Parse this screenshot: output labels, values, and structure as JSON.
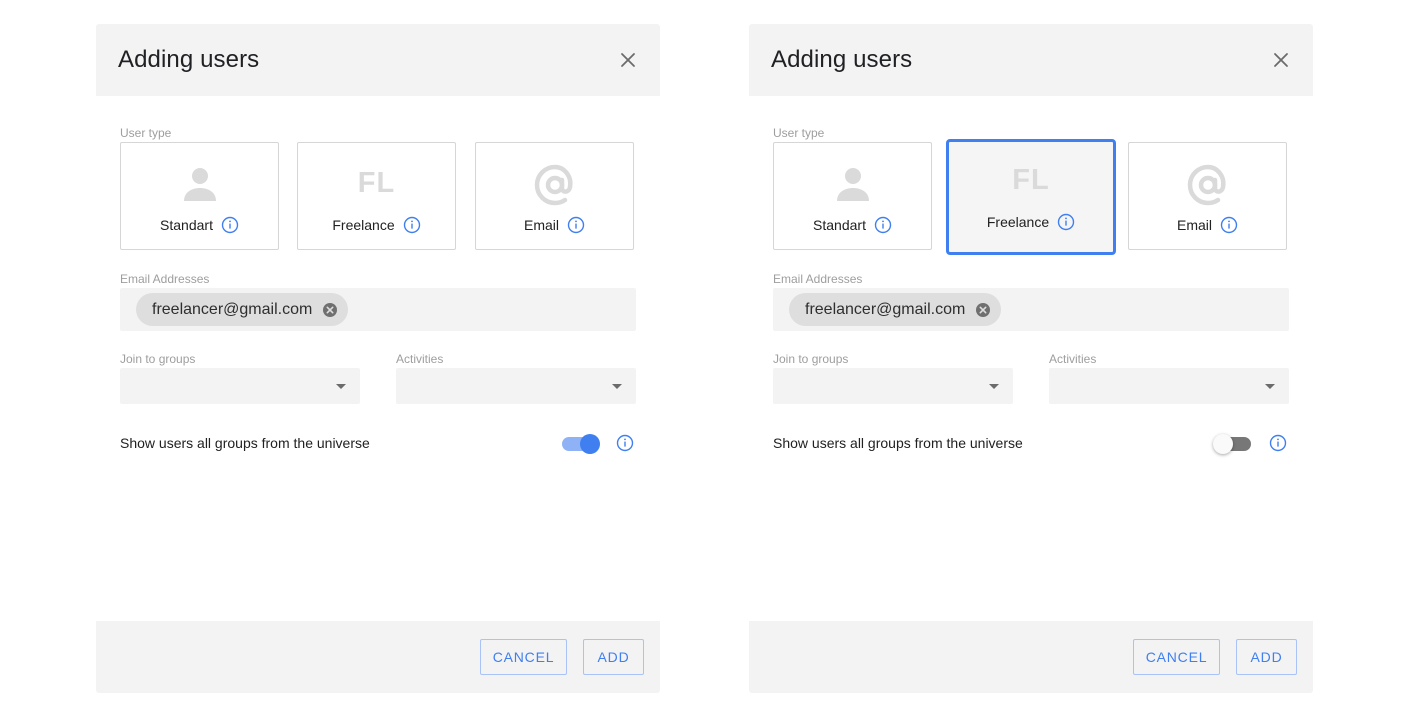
{
  "colors": {
    "accent": "#3f7ff0",
    "header_bg": "#f3f3f3",
    "muted_label": "#9e9e9e"
  },
  "dialogs": [
    {
      "title": "Adding users",
      "user_type_label": "User type",
      "user_types": [
        {
          "label": "Standart",
          "icon": "person-icon",
          "selected": false
        },
        {
          "label": "Freelance",
          "icon": "fl-icon",
          "icon_text": "FL",
          "selected": false
        },
        {
          "label": "Email",
          "icon": "at-sign-icon",
          "selected": false
        }
      ],
      "email_label": "Email Addresses",
      "email_chips": [
        "freelancer@gmail.com"
      ],
      "groups_label": "Join to groups",
      "groups_value": "",
      "activities_label": "Activities",
      "activities_value": "",
      "toggle_label": "Show users all groups from the universe",
      "toggle_on": true,
      "cancel_label": "CANCEL",
      "add_label": "ADD"
    },
    {
      "title": "Adding users",
      "user_type_label": "User type",
      "user_types": [
        {
          "label": "Standart",
          "icon": "person-icon",
          "selected": false
        },
        {
          "label": "Freelance",
          "icon": "fl-icon",
          "icon_text": "FL",
          "selected": true
        },
        {
          "label": "Email",
          "icon": "at-sign-icon",
          "selected": false
        }
      ],
      "email_label": "Email Addresses",
      "email_chips": [
        "freelancer@gmail.com"
      ],
      "groups_label": "Join to groups",
      "groups_value": "",
      "activities_label": "Activities",
      "activities_value": "",
      "toggle_label": "Show users all groups from the universe",
      "toggle_on": false,
      "cancel_label": "CANCEL",
      "add_label": "ADD"
    }
  ]
}
